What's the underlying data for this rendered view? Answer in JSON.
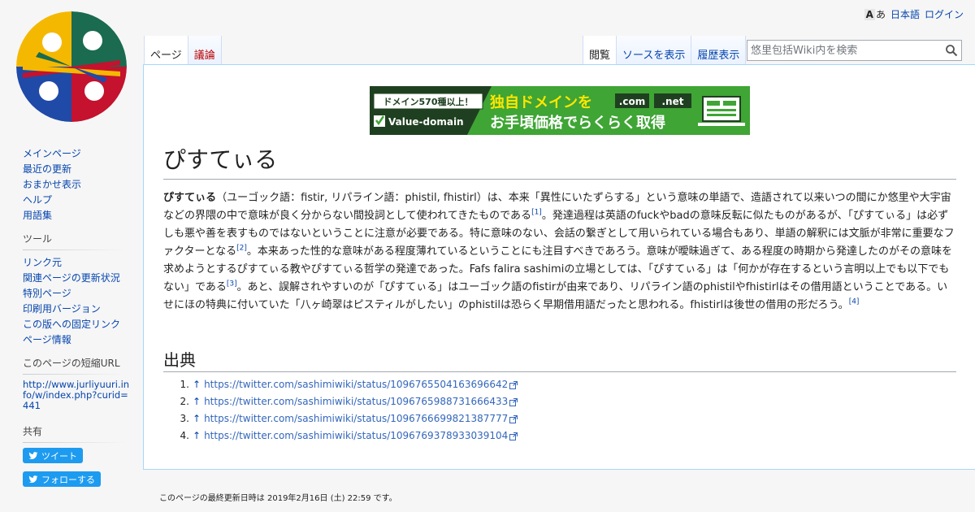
{
  "personal": {
    "language": "日本語",
    "login": "ログイン",
    "lang_icon_a": "A",
    "lang_icon_b": "あ"
  },
  "tabs_left": [
    {
      "label": "ページ"
    },
    {
      "label": "議論"
    }
  ],
  "tabs_right": [
    {
      "label": "閲覧"
    },
    {
      "label": "ソースを表示"
    },
    {
      "label": "履歴表示"
    }
  ],
  "search": {
    "placeholder": "悠里包括Wiki内を検索"
  },
  "banner": {
    "badge": "ドメイン570種以上！",
    "brand": "Value-domain",
    "headline": "独自ドメインを",
    "tld1": ".com",
    "tld2": ".net",
    "subline": "お手頃価格でらくらく取得"
  },
  "page": {
    "title": "ぴすてぃる",
    "body_segments": [
      {
        "b": "ぴすてぃる"
      },
      {
        "t": "（ユーゴック語：fistir, リパライン語：phistil, fhistirl）は、本来「異性にいたずらする」という意味の単語で、造語されて以来いつの間にか悠里や大宇宙などの界隈の中で意味が良く分からない間投詞として使われてきたものである"
      },
      {
        "s": "[1]"
      },
      {
        "t": "。発達過程は英語のfuckやbadの意味反転に似たものがあるが、「ぴすてぃる」は必ずしも悪や善を表すものではないということに注意が必要である。特に意味のない、会話の繋ぎとして用いられている場合もあり、単語の解釈には文脈が非常に重要なファクターとなる"
      },
      {
        "s": "[2]"
      },
      {
        "t": "。本来あった性的な意味がある程度薄れているということにも注目すべきであろう。意味が曖昧過ぎて、ある程度の時期から発達したのがその意味を求めようとするぴすてぃる教やぴすてぃる哲学の発達であった。Fafs falira sashimiの立場としては、「ぴすてぃる」は「何かが存在するという言明以上でも以下でもない」である"
      },
      {
        "s": "[3]"
      },
      {
        "t": "。あと、誤解されやすいのが「ぴすてぃる」はユーゴック語のfistirが由来であり、リパライン語のphistilやfhistirlはその借用語ということである。いせにほの特典に付いていた「八ヶ崎翠はピスティルがしたい」のphistilは恐らく早期借用語だったと思われる。fhistirlは後世の借用の形だろう。"
      },
      {
        "s": "[4]"
      }
    ],
    "refs_heading": "出典",
    "refs": [
      {
        "num": "1.",
        "arrow": "↑",
        "url": "https://twitter.com/sashimiwiki/status/1096765504163696642"
      },
      {
        "num": "2.",
        "arrow": "↑",
        "url": "https://twitter.com/sashimiwiki/status/1096765988731666433"
      },
      {
        "num": "3.",
        "arrow": "↑",
        "url": "https://twitter.com/sashimiwiki/status/1096766699821387777"
      },
      {
        "num": "4.",
        "arrow": "↑",
        "url": "https://twitter.com/sashimiwiki/status/1096769378933039104"
      }
    ]
  },
  "sidebar": {
    "navigation": [
      {
        "label": "メインページ"
      },
      {
        "label": "最近の更新"
      },
      {
        "label": "おまかせ表示"
      },
      {
        "label": "ヘルプ"
      },
      {
        "label": "用語集"
      }
    ],
    "tools_heading": "ツール",
    "tools": [
      {
        "label": "リンク元"
      },
      {
        "label": "関連ページの更新状況"
      },
      {
        "label": "特別ページ"
      },
      {
        "label": "印刷用バージョン"
      },
      {
        "label": "この版への固定リンク"
      },
      {
        "label": "ページ情報"
      }
    ],
    "shorturl_heading": "このページの短縮URL",
    "shorturl": "http://www.jurliyuuri.info/w/index.php?curid=441",
    "share_heading": "共有",
    "tweet": "ツイート",
    "follow": "フォローする"
  },
  "footer": {
    "lastmod": "このページの最終更新日時は 2019年2月16日 (土) 22:59 です。"
  },
  "colors": {
    "link": "#0645ad",
    "redlink": "#ba0000",
    "twitter": "#1d9bf0",
    "logo_yellow": "#f5b800",
    "logo_green": "#1a6b4f",
    "logo_red": "#c4122f",
    "logo_blue": "#1f4aa8"
  }
}
